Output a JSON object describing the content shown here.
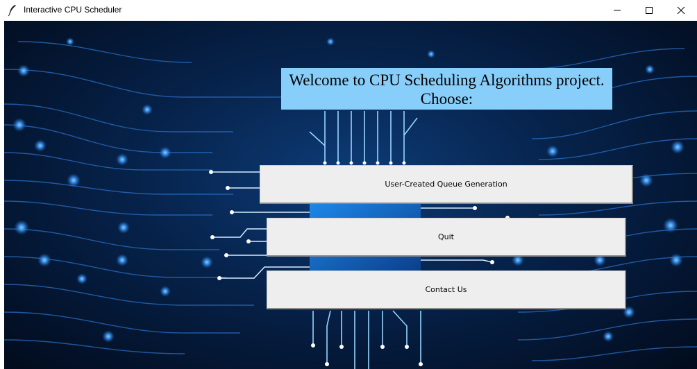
{
  "window": {
    "title": "Interactive CPU Scheduler",
    "controls": {
      "minimize": "minimize-icon",
      "maximize": "maximize-icon",
      "close": "close-icon"
    }
  },
  "main": {
    "welcome_text": "Welcome to CPU Scheduling Algorithms project.\nChoose:",
    "buttons": [
      {
        "label": "User-Created Queue Generation"
      },
      {
        "label": "Quit"
      },
      {
        "label": "Contact Us"
      }
    ]
  },
  "colors": {
    "welcome_bg": "#87cefa",
    "button_bg": "#eeeeee",
    "circuit_line": "#2f7fd8",
    "circuit_glow": "#4aa8ff"
  }
}
